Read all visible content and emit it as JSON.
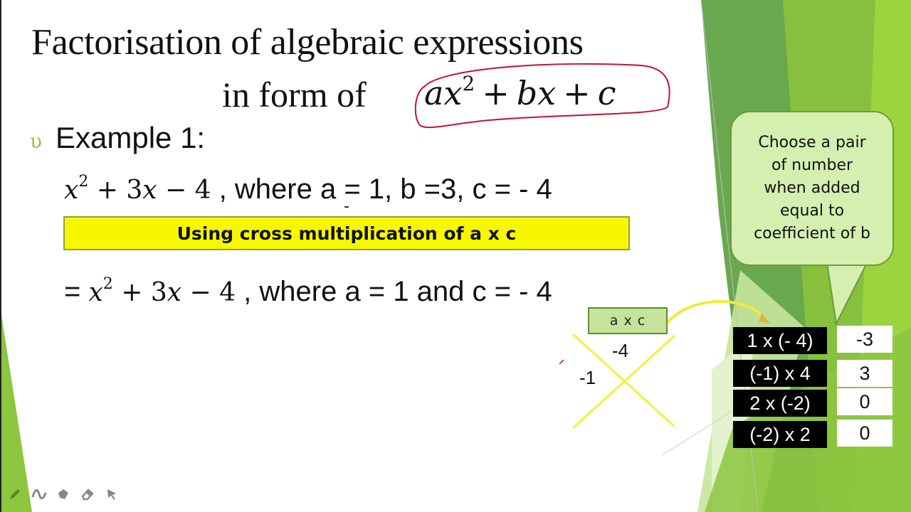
{
  "slide": {
    "title_line1": "Factorisation of algebraic expressions",
    "title_line2": "in form of",
    "general_form": {
      "a": "a",
      "x": "x",
      "exp": "2",
      "plus1": "+",
      "b": "b",
      "x2": "x",
      "plus2": "+",
      "c": "c"
    },
    "bullet_glyph": "υ",
    "example_label": "Example 1:",
    "equation1": {
      "math_prefix": "",
      "x": "x",
      "exp": "2",
      "rest": " + 3",
      "x2": "x",
      "tail": " − 4",
      "text": " , where a = 1, b =3, c = - 4"
    },
    "method_banner": "Using cross multiplication of a x  c",
    "equation2": {
      "eq_sign": "= ",
      "x": "x",
      "exp": "2",
      "rest": " + 3",
      "x2": "x",
      "tail": " − 4",
      "text": " , where a = 1 and c = - 4"
    },
    "cross_diagram": {
      "header": "a x c",
      "top_value": "-4",
      "left_value": "-1"
    },
    "callout": {
      "text": "Choose a pair\nof number\nwhen added\nequal to\ncoefficient of b"
    },
    "pairs": [
      {
        "label": "1 x (- 4)",
        "sum": "-3"
      },
      {
        "label": "(-1) x 4",
        "sum": "3"
      },
      {
        "label": "2 x (-2)",
        "sum": "0"
      },
      {
        "label": "(-2) x  2",
        "sum": "0"
      }
    ]
  },
  "toolbar": {
    "tools": [
      {
        "icon": "pen-icon"
      },
      {
        "icon": "highlighter-icon"
      },
      {
        "icon": "fill-bucket-icon"
      },
      {
        "icon": "eraser-icon"
      },
      {
        "icon": "pointer-arrow-icon"
      }
    ]
  },
  "colors": {
    "accent_green": "#8dc63f",
    "dark_green": "#5e9a3a",
    "banner_yellow": "#f7f700",
    "annotation_red": "#c8102e",
    "cross_yellow": "#f2f23a"
  }
}
